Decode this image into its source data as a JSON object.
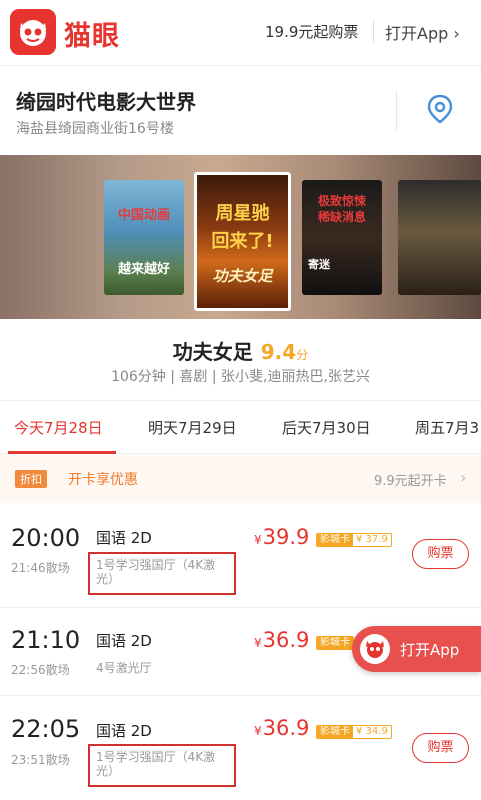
{
  "header": {
    "brand": "猫眼",
    "price_text": "19.9元起购票",
    "open_app": "打开App ›"
  },
  "cinema": {
    "name": "绮园时代电影大世界",
    "address": "海盐县绮园商业街16号楼"
  },
  "posters": [
    {
      "line1": "中国动画",
      "line2": "越来越好"
    },
    {
      "line1": "周星驰",
      "line2": "回来了!",
      "line3": "功夫女足"
    },
    {
      "line1": "极致惊悚",
      "line2": "稀缺消息",
      "line3": "寄迷"
    },
    {
      "line1": "",
      "line2": ""
    }
  ],
  "movie": {
    "title": "功夫女足",
    "score": "9.4",
    "score_unit": "分",
    "meta": "106分钟 | 喜剧 | 张小斐,迪丽热巴,张艺兴"
  },
  "tabs": [
    {
      "label": "今天7月28日",
      "active": true
    },
    {
      "label": "明天7月29日",
      "active": false
    },
    {
      "label": "后天7月30日",
      "active": false
    },
    {
      "label": "周五7月3",
      "active": false
    }
  ],
  "discount": {
    "badge": "折扣",
    "text": "开卡享优惠",
    "right": "9.9元起开卡",
    "arrow": "›"
  },
  "showtimes": [
    {
      "time": "20:00",
      "end": "21:46散场",
      "lang": "国语 2D",
      "hall": "1号学习强国厅（4K激光）",
      "currency": "¥",
      "price": "39.9",
      "card_label": "影城卡",
      "card_price": "¥ 37.9",
      "buy": "购票"
    },
    {
      "time": "21:10",
      "end": "22:56散场",
      "lang": "国语 2D",
      "hall": "4号激光厅",
      "currency": "¥",
      "price": "36.9",
      "card_label": "影城卡",
      "card_price": "",
      "buy": ""
    },
    {
      "time": "22:05",
      "end": "23:51散场",
      "lang": "国语 2D",
      "hall": "1号学习强国厅（4K激光）",
      "currency": "¥",
      "price": "36.9",
      "card_label": "影城卡",
      "card_price": "¥ 34.9",
      "buy": "购票"
    }
  ],
  "float_app": {
    "label": "打开App"
  },
  "colors": {
    "brand_red": "#e6342f",
    "score_orange": "#f5a623",
    "discount_orange": "#f07b2a"
  }
}
